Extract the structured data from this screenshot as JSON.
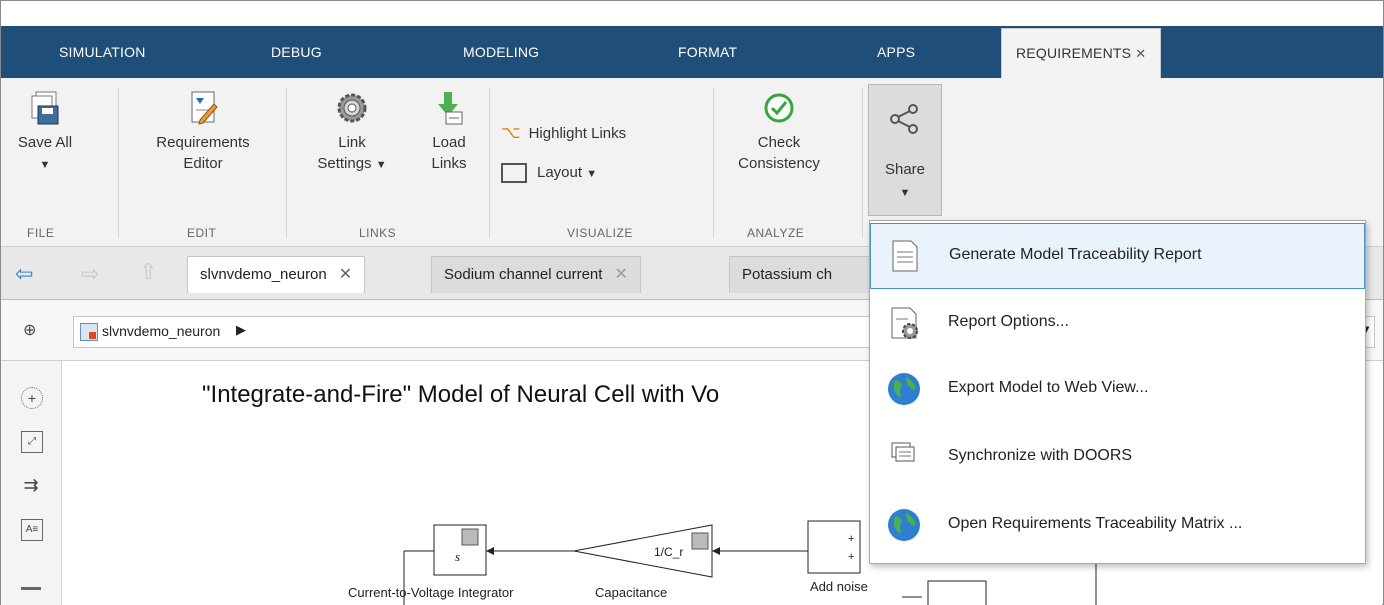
{
  "tabs": [
    {
      "label": "SIMULATION"
    },
    {
      "label": "DEBUG"
    },
    {
      "label": "MODELING"
    },
    {
      "label": "FORMAT"
    },
    {
      "label": "APPS"
    },
    {
      "label": "REQUIREMENTS",
      "active": true
    }
  ],
  "tab_close": "✕",
  "ribbon": {
    "save_all": "Save All",
    "requirements_editor_l1": "Requirements",
    "requirements_editor_l2": "Editor",
    "link_settings_l1": "Link",
    "link_settings_l2": "Settings",
    "load_links_l1": "Load",
    "load_links_l2": "Links",
    "highlight_links": "Highlight Links",
    "layout": "Layout",
    "check_l1": "Check",
    "check_l2": "Consistency",
    "share": "Share",
    "groups": {
      "file": "FILE",
      "edit": "EDIT",
      "links": "LINKS",
      "visualize": "VISUALIZE",
      "analyze": "ANALYZE"
    }
  },
  "editor_tabs": [
    {
      "label": "slvnvdemo_neuron"
    },
    {
      "label": "Sodium channel current"
    },
    {
      "label": "Potassium ch"
    }
  ],
  "close_glyph": "✕",
  "breadcrumb": "slvnvdemo_neuron",
  "canvas": {
    "title": "\"Integrate-and-Fire\" Model of Neural Cell with Vo",
    "labels": {
      "integrator": "Current-to-Voltage Integrator",
      "capacitance": "Capacitance",
      "add_noise": "Add noise",
      "gain": "1/C_r",
      "integrator_sym": "s"
    }
  },
  "share_menu": [
    {
      "label": "Generate Model Traceability Report",
      "icon": "report-icon",
      "highlighted": true
    },
    {
      "label": "Report Options...",
      "icon": "report-options-icon"
    },
    {
      "label": "Export Model to Web View...",
      "icon": "globe-icon"
    },
    {
      "label": "Synchronize with DOORS",
      "icon": "doors-sync-icon"
    },
    {
      "label": "Open Requirements Traceability Matrix ...",
      "icon": "globe-icon"
    }
  ],
  "colors": {
    "tabbar": "#1f4e79",
    "menu_highlight": "#eaf3fb",
    "check_green": "#3aa53a"
  }
}
